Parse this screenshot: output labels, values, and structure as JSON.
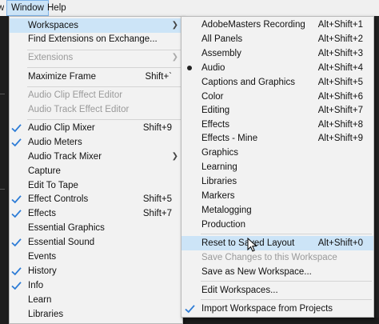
{
  "menubar": {
    "clipped_label": "w",
    "window_label": "Window",
    "help_label": "Help"
  },
  "window_menu": {
    "items": [
      {
        "label": "Workspaces",
        "shortcut": "",
        "submenu": true,
        "checked": false,
        "disabled": false,
        "highlighted": true
      },
      {
        "label": "Find Extensions on Exchange...",
        "shortcut": "",
        "submenu": false,
        "checked": false,
        "disabled": false
      },
      {
        "label": "Extensions",
        "shortcut": "",
        "submenu": true,
        "checked": false,
        "disabled": true
      },
      {
        "label": "Maximize Frame",
        "shortcut": "Shift+`",
        "submenu": false,
        "checked": false,
        "disabled": false
      },
      {
        "label": "Audio Clip Effect Editor",
        "shortcut": "",
        "submenu": false,
        "checked": false,
        "disabled": true
      },
      {
        "label": "Audio Track Effect Editor",
        "shortcut": "",
        "submenu": false,
        "checked": false,
        "disabled": true
      },
      {
        "label": "Audio Clip Mixer",
        "shortcut": "Shift+9",
        "submenu": false,
        "checked": true,
        "disabled": false
      },
      {
        "label": "Audio Meters",
        "shortcut": "",
        "submenu": false,
        "checked": true,
        "disabled": false
      },
      {
        "label": "Audio Track Mixer",
        "shortcut": "",
        "submenu": true,
        "checked": false,
        "disabled": false
      },
      {
        "label": "Capture",
        "shortcut": "",
        "submenu": false,
        "checked": false,
        "disabled": false
      },
      {
        "label": "Edit To Tape",
        "shortcut": "",
        "submenu": false,
        "checked": false,
        "disabled": false
      },
      {
        "label": "Effect Controls",
        "shortcut": "Shift+5",
        "submenu": false,
        "checked": true,
        "disabled": false
      },
      {
        "label": "Effects",
        "shortcut": "Shift+7",
        "submenu": false,
        "checked": true,
        "disabled": false
      },
      {
        "label": "Essential Graphics",
        "shortcut": "",
        "submenu": false,
        "checked": false,
        "disabled": false
      },
      {
        "label": "Essential Sound",
        "shortcut": "",
        "submenu": false,
        "checked": true,
        "disabled": false
      },
      {
        "label": "Events",
        "shortcut": "",
        "submenu": false,
        "checked": false,
        "disabled": false
      },
      {
        "label": "History",
        "shortcut": "",
        "submenu": false,
        "checked": true,
        "disabled": false
      },
      {
        "label": "Info",
        "shortcut": "",
        "submenu": false,
        "checked": true,
        "disabled": false
      },
      {
        "label": "Learn",
        "shortcut": "",
        "submenu": false,
        "checked": false,
        "disabled": false
      },
      {
        "label": "Libraries",
        "shortcut": "",
        "submenu": false,
        "checked": false,
        "disabled": false
      }
    ]
  },
  "workspaces_menu": {
    "items": [
      {
        "label": "AdobeMasters Recording",
        "shortcut": "Alt+Shift+1",
        "mark": "",
        "disabled": false
      },
      {
        "label": "All Panels",
        "shortcut": "Alt+Shift+2",
        "mark": "",
        "disabled": false
      },
      {
        "label": "Assembly",
        "shortcut": "Alt+Shift+3",
        "mark": "",
        "disabled": false
      },
      {
        "label": "Audio",
        "shortcut": "Alt+Shift+4",
        "mark": "bullet",
        "disabled": false
      },
      {
        "label": "Captions and Graphics",
        "shortcut": "Alt+Shift+5",
        "mark": "",
        "disabled": false
      },
      {
        "label": "Color",
        "shortcut": "Alt+Shift+6",
        "mark": "",
        "disabled": false
      },
      {
        "label": "Editing",
        "shortcut": "Alt+Shift+7",
        "mark": "",
        "disabled": false
      },
      {
        "label": "Effects",
        "shortcut": "Alt+Shift+8",
        "mark": "",
        "disabled": false
      },
      {
        "label": "Effects - Mine",
        "shortcut": "Alt+Shift+9",
        "mark": "",
        "disabled": false
      },
      {
        "label": "Graphics",
        "shortcut": "",
        "mark": "",
        "disabled": false
      },
      {
        "label": "Learning",
        "shortcut": "",
        "mark": "",
        "disabled": false
      },
      {
        "label": "Libraries",
        "shortcut": "",
        "mark": "",
        "disabled": false
      },
      {
        "label": "Markers",
        "shortcut": "",
        "mark": "",
        "disabled": false
      },
      {
        "label": "Metalogging",
        "shortcut": "",
        "mark": "",
        "disabled": false
      },
      {
        "label": "Production",
        "shortcut": "",
        "mark": "",
        "disabled": false
      },
      {
        "label": "Reset to Saved Layout",
        "shortcut": "Alt+Shift+0",
        "mark": "",
        "disabled": false,
        "highlighted": true
      },
      {
        "label": "Save Changes to this Workspace",
        "shortcut": "",
        "mark": "",
        "disabled": true
      },
      {
        "label": "Save as New Workspace...",
        "shortcut": "",
        "mark": "",
        "disabled": false
      },
      {
        "label": "Edit Workspaces...",
        "shortcut": "",
        "mark": "",
        "disabled": false
      },
      {
        "label": "Import Workspace from Projects",
        "shortcut": "",
        "mark": "check",
        "disabled": false
      }
    ]
  },
  "colors": {
    "highlight": "#cce4f7",
    "check": "#2b7bd6",
    "disabled_text": "#9a9a9a"
  }
}
